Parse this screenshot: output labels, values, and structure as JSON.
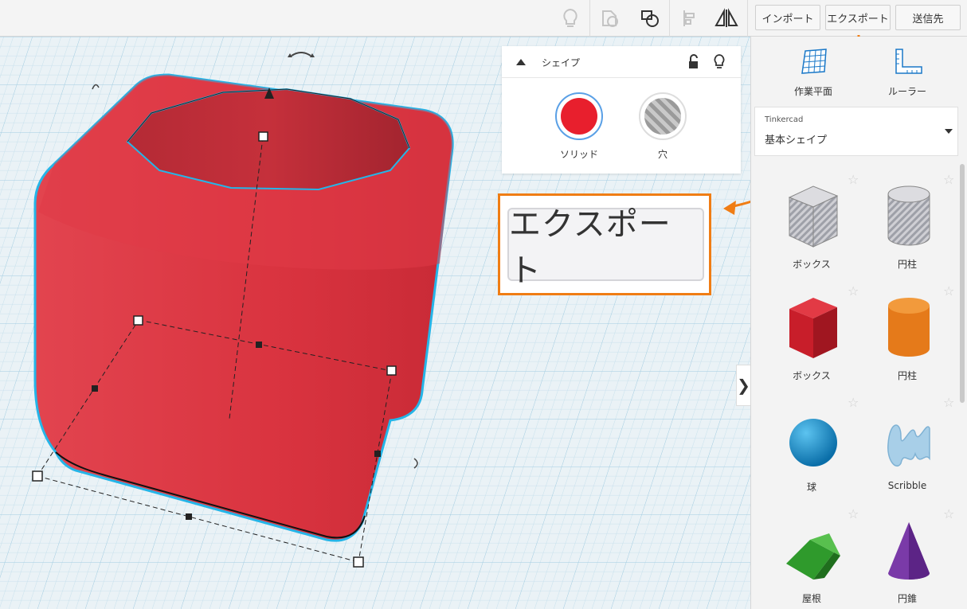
{
  "toolbar": {
    "import_label": "インポート",
    "export_label": "エクスポート",
    "send_label": "送信先",
    "icons": [
      "lightbulb-icon",
      "shape-outline-icon",
      "shape-solid-icon",
      "align-icon",
      "mirror-icon"
    ]
  },
  "inspector": {
    "title": "シェイプ",
    "solid_label": "ソリッド",
    "hole_label": "穴",
    "solid_color": "#e81f2d"
  },
  "callout": {
    "label": "エクスポート",
    "accent_color": "#f07d14"
  },
  "rightpanel": {
    "workplane_label": "作業平面",
    "ruler_label": "ルーラー",
    "library_source": "Tinkercad",
    "library_name": "基本シェイプ",
    "shapes": [
      {
        "label": "ボックス"
      },
      {
        "label": "円柱"
      },
      {
        "label": "ボックス"
      },
      {
        "label": "円柱"
      },
      {
        "label": "球"
      },
      {
        "label": "Scribble"
      },
      {
        "label": "屋根"
      },
      {
        "label": "円錐"
      }
    ]
  },
  "colors": {
    "shape_red": "#dc3340",
    "selection_outline": "#25b5e8",
    "grid": "#b9d9e8"
  }
}
